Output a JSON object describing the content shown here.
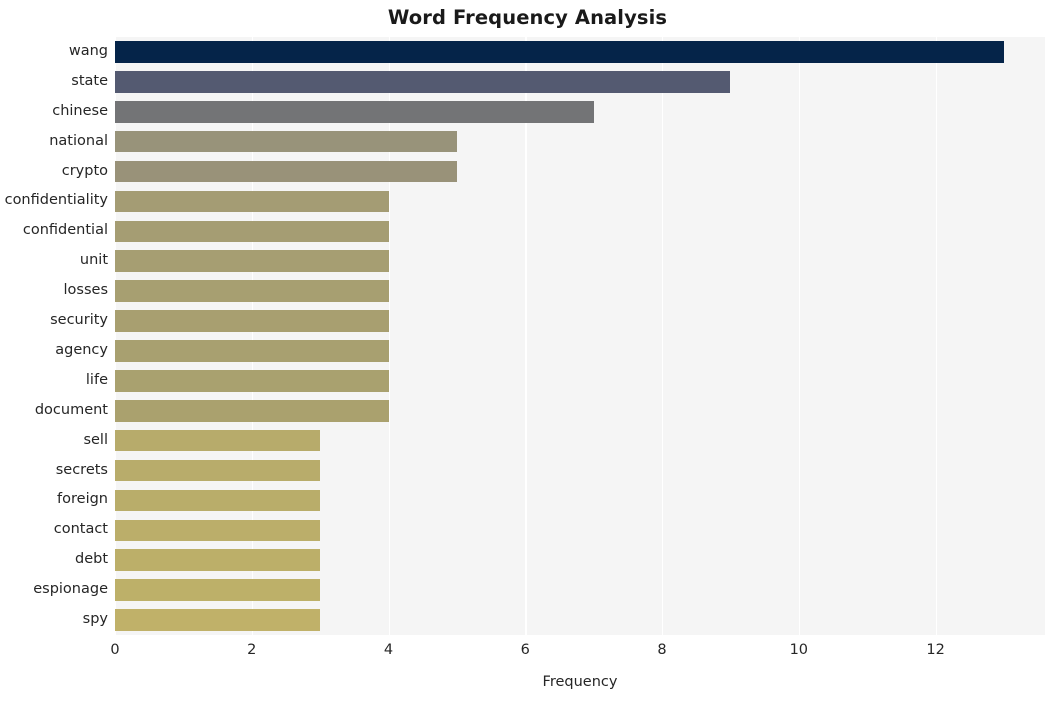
{
  "chart_data": {
    "type": "bar",
    "orientation": "horizontal",
    "title": "Word Frequency Analysis",
    "xlabel": "Frequency",
    "ylabel": "",
    "categories": [
      "wang",
      "state",
      "chinese",
      "national",
      "crypto",
      "confidentiality",
      "confidential",
      "unit",
      "losses",
      "security",
      "agency",
      "life",
      "document",
      "sell",
      "secrets",
      "foreign",
      "contact",
      "debt",
      "espionage",
      "spy"
    ],
    "values": [
      13,
      9,
      7,
      5,
      5,
      4,
      4,
      4,
      4,
      4,
      4,
      4,
      4,
      3,
      3,
      3,
      3,
      3,
      3,
      3
    ],
    "bar_colors": [
      "#052449",
      "#545a71",
      "#737476",
      "#98937a",
      "#999279",
      "#a49c74",
      "#a59d73",
      "#a69e72",
      "#a79f71",
      "#a89f70",
      "#a8a070",
      "#a9a16f",
      "#aaa16e",
      "#b7ab6b",
      "#b8ac6b",
      "#b9ad6a",
      "#bbae6a",
      "#bcaf69",
      "#bdb069",
      "#c0b169"
    ],
    "xticks": [
      0,
      2,
      4,
      6,
      8,
      10,
      12
    ],
    "xtick_labels": [
      "0",
      "2",
      "4",
      "6",
      "8",
      "10",
      "12"
    ],
    "xlim": [
      0,
      13.6
    ],
    "ylim_categories": 20,
    "grid": true,
    "grid_axis": "x",
    "grid_color": "#ffffff",
    "plot_background": "#f5f5f5",
    "figure_background": "#ffffff",
    "legend": null,
    "style": "whitegrid"
  }
}
